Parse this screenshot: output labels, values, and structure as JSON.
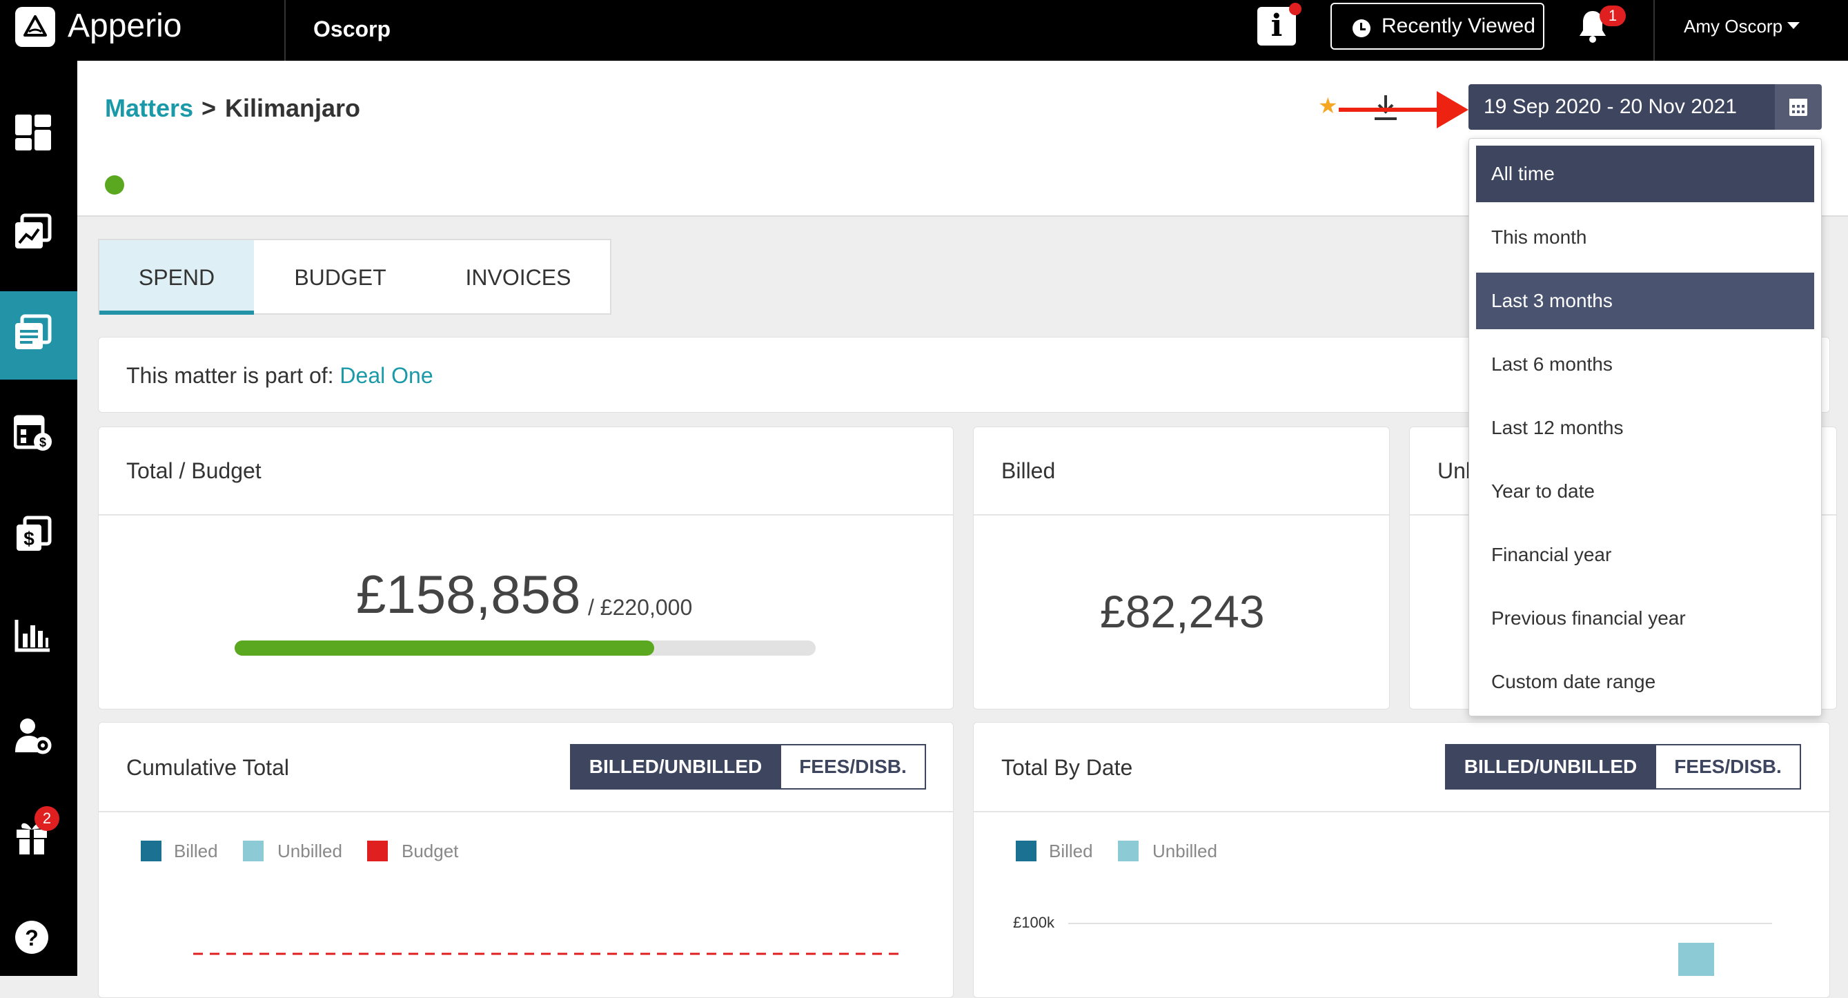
{
  "app": {
    "brand": "Apperio",
    "org": "Oscorp"
  },
  "topbar": {
    "recently_viewed": "Recently Viewed",
    "notif_count": "1",
    "user": "Amy Oscorp"
  },
  "sidebar": {
    "gift_count": "2"
  },
  "breadcrumb": {
    "parent": "Matters",
    "sep": ">",
    "current": "Kilimanjaro"
  },
  "date_range": {
    "value": "19 Sep 2020 - 20 Nov 2021"
  },
  "date_options": [
    "All time",
    "This month",
    "Last 3 months",
    "Last 6 months",
    "Last 12 months",
    "Year to date",
    "Financial year",
    "Previous financial year",
    "Custom date range"
  ],
  "tabs": [
    "SPEND",
    "BUDGET",
    "INVOICES"
  ],
  "deal": {
    "prefix": "This matter is part of: ",
    "link": "Deal One"
  },
  "total_budget": {
    "title": "Total / Budget",
    "total": "£158,858",
    "budget": "/ £220,000",
    "progress": 0.722
  },
  "billed": {
    "title": "Billed",
    "amount": "£82,243"
  },
  "unbilled": {
    "title": "Unbilled"
  },
  "cumulative": {
    "title": "Cumulative Total",
    "toggle_on": "BILLED/UNBILLED",
    "toggle_off": "FEES/DISB.",
    "legend": [
      "Billed",
      "Unbilled",
      "Budget"
    ]
  },
  "by_date": {
    "title": "Total By Date",
    "toggle_on": "BILLED/UNBILLED",
    "toggle_off": "FEES/DISB.",
    "legend": [
      "Billed",
      "Unbilled"
    ],
    "y_tick": "£100k"
  },
  "colors": {
    "accent": "#1a9aa8",
    "active_nav": "#2394a8",
    "billed": "#1a7191",
    "unbilled": "#8ccad6",
    "budget": "#e02020",
    "progress": "#5aa820",
    "dark": "#3e455e"
  }
}
